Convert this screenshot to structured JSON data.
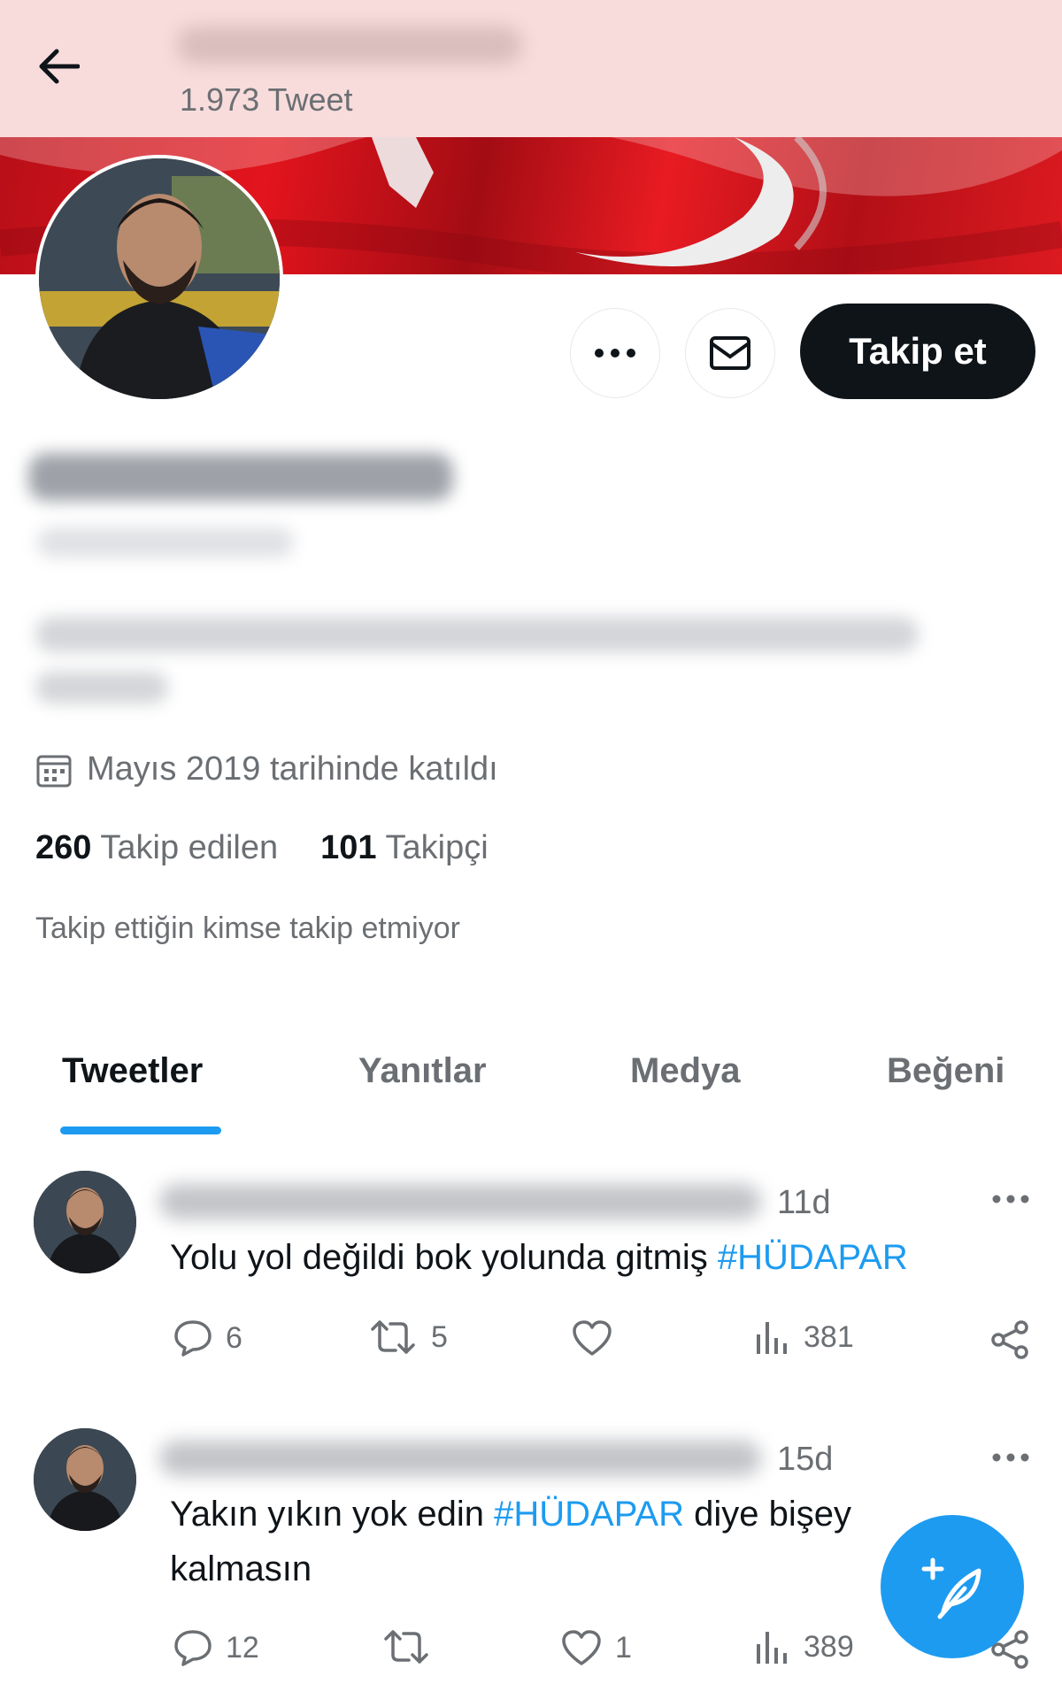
{
  "header": {
    "tweet_count": "1.973 Tweet"
  },
  "profile": {
    "follow_label": "Takip et",
    "joined": "Mayıs 2019 tarihinde katıldı",
    "following_count": "260",
    "following_label": "Takip edilen",
    "followers_count": "101",
    "followers_label": "Takipçi",
    "mutuals_note": "Takip ettiğin kimse takip etmiyor"
  },
  "tabs": [
    "Tweetler",
    "Yanıtlar",
    "Medya",
    "Beğeni"
  ],
  "tweets": [
    {
      "time": "11d",
      "text_before": "Yolu yol değildi bok yolunda gitmiş ",
      "hashtag": "#HÜDAPAR",
      "text_after": "",
      "replies": "6",
      "retweets": "5",
      "likes": "",
      "views": "381"
    },
    {
      "time": "15d",
      "text_before": "Yakın yıkın yok edin ",
      "hashtag": "#HÜDAPAR",
      "text_after": " diye bişey kalmasın",
      "replies": "12",
      "retweets": "",
      "likes": "1",
      "views": "389"
    }
  ],
  "icons": {
    "back": "arrow-left-icon",
    "more": "more-horizontal-icon",
    "message": "envelope-icon",
    "calendar": "calendar-icon",
    "reply": "speech-bubble-icon",
    "retweet": "retweet-icon",
    "like": "heart-icon",
    "views": "bar-chart-icon",
    "share": "share-icon",
    "compose": "feather-plus-icon"
  },
  "colors": {
    "accent": "#1d9bf0",
    "text": "#0f1419",
    "muted": "#6b6f73",
    "banner_red": "#e3141d"
  }
}
